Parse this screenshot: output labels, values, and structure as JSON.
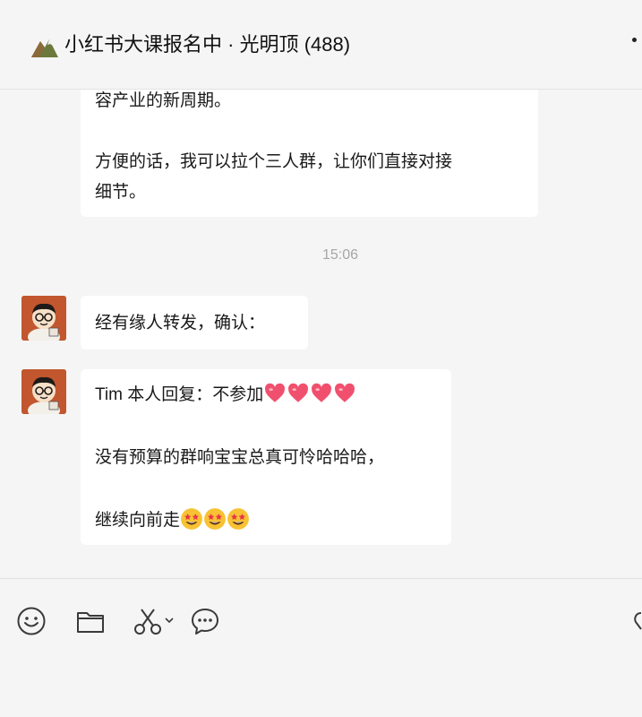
{
  "header": {
    "group_name": "小红书大课报名中 · 光明顶",
    "member_count": "(488)"
  },
  "messages": {
    "first_bubble": {
      "line1": "容产业的新周期。",
      "line2": "方便的话，我可以拉个三人群，让你们直接对接",
      "line3": "细节。"
    },
    "timestamp": "15:06",
    "second_bubble": {
      "text": "经有缘人转发，确认："
    },
    "third_bubble": {
      "line1": "Tim 本人回复：不参加",
      "line2": "没有预算的群响宝宝总真可怜哈哈哈，",
      "line3": "继续向前走"
    }
  },
  "toolbar": {
    "icons": [
      "emoji-icon",
      "folder-icon",
      "scissors-icon",
      "chevron-down-icon",
      "chat-bubble-icon"
    ]
  },
  "colors": {
    "background": "#f5f5f5",
    "bubble": "#ffffff",
    "heart": "#f0506e",
    "avatar": "#c2562e"
  }
}
